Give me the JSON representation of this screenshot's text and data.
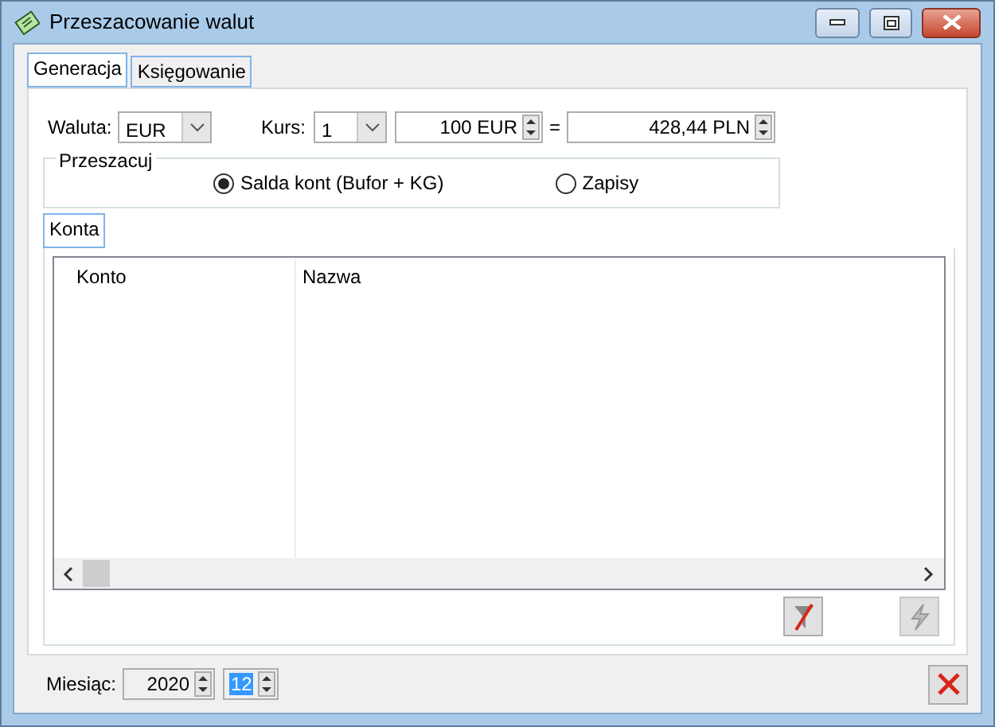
{
  "window": {
    "title": "Przeszacowanie walut"
  },
  "tabs": [
    {
      "label": "Generacja",
      "selected": true
    },
    {
      "label": "Księgowanie",
      "selected": false
    }
  ],
  "currency": {
    "label": "Waluta:",
    "value": "EUR"
  },
  "rate": {
    "label": "Kurs:",
    "value": "1",
    "amount": "100 EUR",
    "equals": "=",
    "result": "428,44 PLN"
  },
  "revalue_group": {
    "title": "Przeszacuj",
    "options": [
      {
        "label": "Salda kont (Bufor + KG)",
        "selected": true
      },
      {
        "label": "Zapisy",
        "selected": false
      }
    ]
  },
  "subtabs": [
    {
      "label": "Konta",
      "selected": true
    }
  ],
  "table": {
    "columns": [
      "Konto",
      "Nazwa"
    ]
  },
  "actions": [
    {
      "kind": "clear",
      "disabled": false
    },
    {
      "kind": "generate",
      "disabled": true
    }
  ],
  "month": {
    "label": "Miesiąc:",
    "year": "2020",
    "month": "12"
  }
}
